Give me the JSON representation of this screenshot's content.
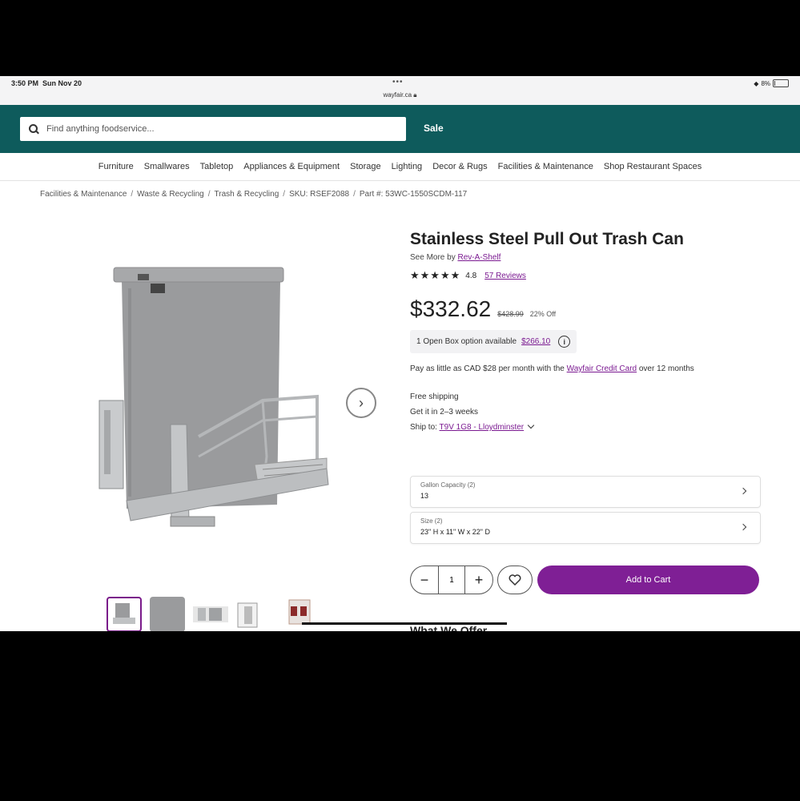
{
  "status_bar": {
    "time": "3:50 PM",
    "date": "Sun Nov 20",
    "url": "wayfair.ca",
    "battery": "8%",
    "battery_level": 0.08
  },
  "header": {
    "search_placeholder": "Find anything foodservice...",
    "sale_label": "Sale",
    "brand_color": "#0e5b5c"
  },
  "nav": {
    "items": [
      "Furniture",
      "Smallwares",
      "Tabletop",
      "Appliances & Equipment",
      "Storage",
      "Lighting",
      "Decor & Rugs",
      "Facilities & Maintenance",
      "Shop Restaurant Spaces"
    ]
  },
  "breadcrumb": [
    "Facilities & Maintenance",
    "Waste & Recycling",
    "Trash & Recycling",
    "SKU: RSEF2088",
    "Part #: 53WC-1550SCDM-117"
  ],
  "product": {
    "title": "Stainless Steel Pull Out Trash Can",
    "see_more": "See More by",
    "brand": "Rev-A-Shelf",
    "stars": "★★★★★",
    "rating": "4.8",
    "reviews": "57 Reviews",
    "price": "$332.62",
    "original_price": "$428.99",
    "discount": "22% Off",
    "open_box_text": "1 Open Box option available",
    "open_box_price": "$266.10",
    "financing_text": "Pay as little as CAD $28 per month with the",
    "financing_link": "Wayfair Credit Card",
    "financing_suffix": "over 12 months",
    "shipping": "Free shipping",
    "delivery": "Get it in 2–3 weeks",
    "ship_to_label": "Ship to:",
    "ship_to_location": "T9V 1G8 - Lloydminster",
    "options": [
      {
        "label": "Gallon Capacity (2)",
        "value": "13"
      },
      {
        "label": "Size (2)",
        "value": "23\" H x 11\" W x 22\" D"
      }
    ],
    "quantity": "1",
    "add_to_cart": "Add to Cart",
    "accent_color": "#7f1f95"
  },
  "gallery": {
    "thumbnail_count": 5,
    "active_index": 0
  },
  "next_section_peek": "What We Offer"
}
